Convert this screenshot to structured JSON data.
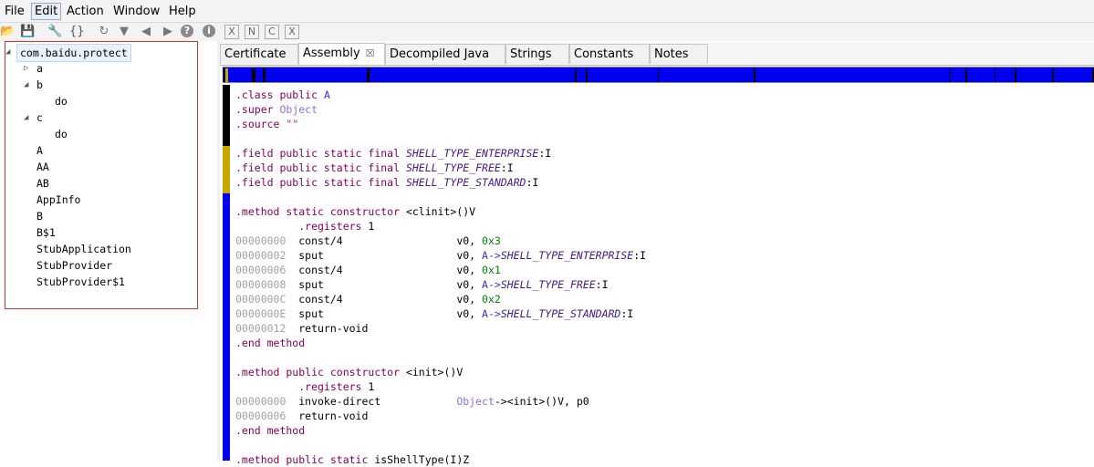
{
  "menu": [
    {
      "label": "File",
      "active": false
    },
    {
      "label": "Edit",
      "active": true
    },
    {
      "label": "Action",
      "active": false
    },
    {
      "label": "Window",
      "active": false
    },
    {
      "label": "Help",
      "active": false
    }
  ],
  "toolbar": [
    {
      "name": "open-icon",
      "glyph": "📂",
      "color": "#d9a520"
    },
    {
      "name": "save-icon",
      "glyph": "💾",
      "color": "#3c6fc2"
    },
    {
      "name": "wrench-icon",
      "glyph": "🔧",
      "color": "#c05a1e"
    },
    {
      "name": "brackets-icon",
      "glyph": "{}",
      "color": "#555555"
    },
    {
      "name": "refresh-icon",
      "glyph": "↻",
      "color": "#777777"
    },
    {
      "name": "filter-icon",
      "glyph": "▼",
      "color": "#777777"
    },
    {
      "name": "back-icon",
      "glyph": "◀",
      "color": "#777777"
    },
    {
      "name": "forward-icon",
      "glyph": "▶",
      "color": "#777777"
    },
    {
      "name": "help-icon",
      "glyph": "?",
      "color": "#777777"
    },
    {
      "name": "info-icon",
      "glyph": "i",
      "color": "#777777"
    },
    {
      "name": "rename-icon",
      "glyph": "X",
      "color": "#666666"
    },
    {
      "name": "comment-icon",
      "glyph": "N",
      "color": "#666666"
    },
    {
      "name": "convert-icon",
      "glyph": "C",
      "color": "#666666"
    },
    {
      "name": "xref-icon",
      "glyph": "X",
      "color": "#666666"
    }
  ],
  "tree": {
    "root": "com.baidu.protect",
    "items": [
      {
        "label": "a",
        "indent": 1,
        "toggle": "collapsed"
      },
      {
        "label": "b",
        "indent": 1,
        "toggle": "expanded"
      },
      {
        "label": "do",
        "indent": 2,
        "toggle": "none"
      },
      {
        "label": "c",
        "indent": 1,
        "toggle": "expanded"
      },
      {
        "label": "do",
        "indent": 2,
        "toggle": "none"
      },
      {
        "label": "A",
        "indent": 1,
        "toggle": "none"
      },
      {
        "label": "AA",
        "indent": 1,
        "toggle": "none"
      },
      {
        "label": "AB",
        "indent": 1,
        "toggle": "none"
      },
      {
        "label": "AppInfo",
        "indent": 1,
        "toggle": "none"
      },
      {
        "label": "B",
        "indent": 1,
        "toggle": "none"
      },
      {
        "label": "B$1",
        "indent": 1,
        "toggle": "none"
      },
      {
        "label": "StubApplication",
        "indent": 1,
        "toggle": "none"
      },
      {
        "label": "StubProvider",
        "indent": 1,
        "toggle": "none"
      },
      {
        "label": "StubProvider$1",
        "indent": 1,
        "toggle": "none"
      }
    ]
  },
  "tabs": [
    {
      "label": "Certificate",
      "active": false
    },
    {
      "label": "Assembly",
      "active": true,
      "close": "☒"
    },
    {
      "label": "Decompiled Java",
      "active": false
    },
    {
      "label": "Strings",
      "active": false
    },
    {
      "label": "Constants",
      "active": false
    },
    {
      "label": "Notes",
      "active": false
    }
  ],
  "code_lines": [
    [
      [
        ".class public ",
        "kw"
      ],
      [
        "A",
        "cls"
      ]
    ],
    [
      [
        ".super ",
        "kw"
      ],
      [
        "Object",
        "objp"
      ]
    ],
    [
      [
        ".source ",
        "kw"
      ],
      [
        "\"\"",
        "str"
      ]
    ],
    [],
    [
      [
        ".field public static final ",
        "kw"
      ],
      [
        "SHELL_TYPE_ENTERPRISE",
        "fld"
      ],
      [
        ":I",
        "reg"
      ]
    ],
    [
      [
        ".field public static final ",
        "kw"
      ],
      [
        "SHELL_TYPE_FREE",
        "fld"
      ],
      [
        ":I",
        "reg"
      ]
    ],
    [
      [
        ".field public static final ",
        "kw"
      ],
      [
        "SHELL_TYPE_STANDARD",
        "fld"
      ],
      [
        ":I",
        "reg"
      ]
    ],
    [],
    [
      [
        ".method static constructor ",
        "kw"
      ],
      [
        "<clinit>()V",
        "reg"
      ]
    ],
    [
      [
        "          .registers ",
        "kw"
      ],
      [
        "1",
        "reg"
      ]
    ],
    [
      [
        "00000000",
        "addr"
      ],
      [
        "  const/4                  v0, ",
        "reg"
      ],
      [
        "0x3",
        "num"
      ]
    ],
    [
      [
        "00000002",
        "addr"
      ],
      [
        "  sput                     v0, ",
        "reg"
      ],
      [
        "A->",
        "cls"
      ],
      [
        "SHELL_TYPE_ENTERPRISE",
        "fld"
      ],
      [
        ":I",
        "reg"
      ]
    ],
    [
      [
        "00000006",
        "addr"
      ],
      [
        "  const/4                  v0, ",
        "reg"
      ],
      [
        "0x1",
        "num"
      ]
    ],
    [
      [
        "00000008",
        "addr"
      ],
      [
        "  sput                     v0, ",
        "reg"
      ],
      [
        "A->",
        "cls"
      ],
      [
        "SHELL_TYPE_FREE",
        "fld"
      ],
      [
        ":I",
        "reg"
      ]
    ],
    [
      [
        "0000000C",
        "addr"
      ],
      [
        "  const/4                  v0, ",
        "reg"
      ],
      [
        "0x2",
        "num"
      ]
    ],
    [
      [
        "0000000E",
        "addr"
      ],
      [
        "  sput                     v0, ",
        "reg"
      ],
      [
        "A->",
        "cls"
      ],
      [
        "SHELL_TYPE_STANDARD",
        "fld"
      ],
      [
        ":I",
        "reg"
      ]
    ],
    [
      [
        "00000012",
        "addr"
      ],
      [
        "  return-void",
        "reg"
      ]
    ],
    [
      [
        ".end method",
        "kw"
      ]
    ],
    [],
    [
      [
        ".method public constructor ",
        "kw"
      ],
      [
        "<init>()V",
        "reg"
      ]
    ],
    [
      [
        "          .registers ",
        "kw"
      ],
      [
        "1",
        "reg"
      ]
    ],
    [
      [
        "00000000",
        "addr"
      ],
      [
        "  invoke-direct            ",
        "reg"
      ],
      [
        "Object",
        "objp"
      ],
      [
        "-><init>()V, p0",
        "reg"
      ]
    ],
    [
      [
        "00000006",
        "addr"
      ],
      [
        "  return-void",
        "reg"
      ]
    ],
    [
      [
        ".end method",
        "kw"
      ]
    ],
    [],
    [
      [
        ".method public static ",
        "kw"
      ],
      [
        "isShellType(I)Z",
        "reg"
      ]
    ]
  ],
  "colors": {
    "overview_bg": "#0000ee",
    "gutter_blue": "#0000ee",
    "gutter_black": "#000000",
    "gutter_gold": "#c8a800",
    "tree_border": "#e0322b"
  }
}
